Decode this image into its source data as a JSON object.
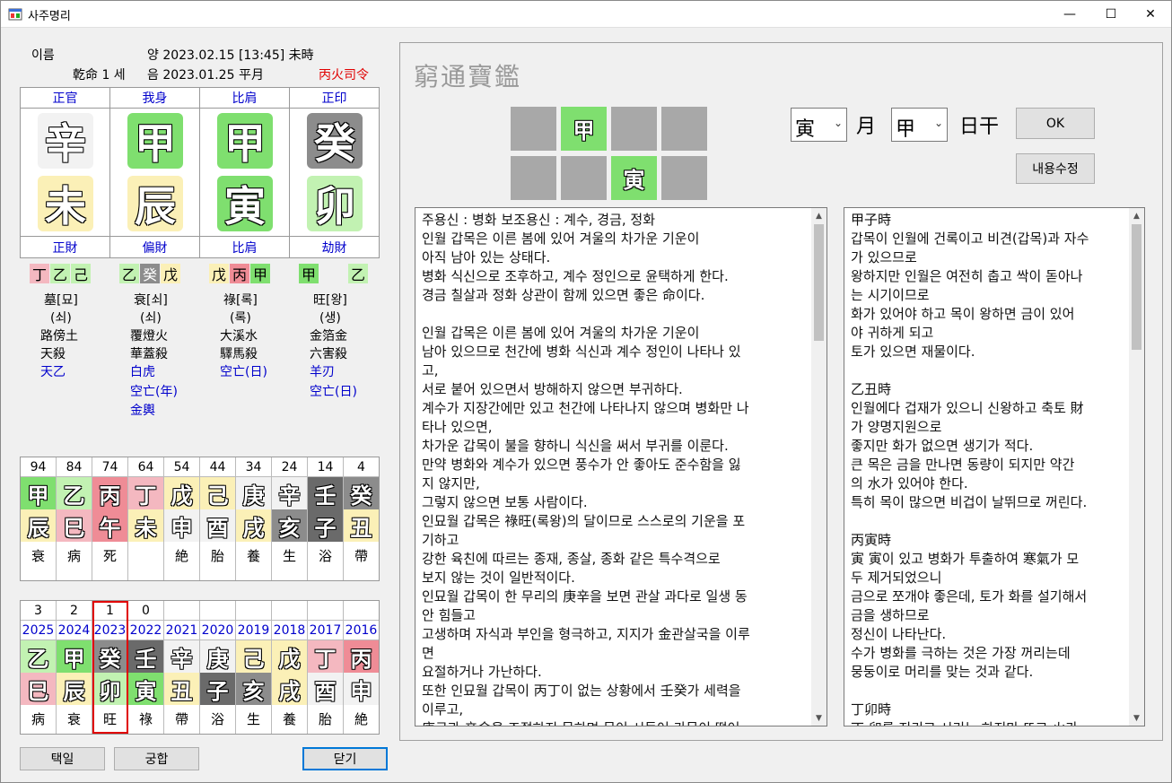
{
  "window": {
    "title": "사주명리",
    "minimize": "—",
    "maximize": "☐",
    "close": "✕"
  },
  "info": {
    "name_label": "이름",
    "solar": "양 2023.02.15  [13:45]  未時",
    "gender_age": "乾命 1 세",
    "lunar": "음 2023.01.25  平月",
    "siryeong": "丙火司令"
  },
  "pillars": {
    "top_labels": [
      "正官",
      "我身",
      "比肩",
      "正印"
    ],
    "stems": [
      "辛",
      "甲",
      "甲",
      "癸"
    ],
    "branches": [
      "未",
      "辰",
      "寅",
      "卯"
    ],
    "bottom_labels": [
      "正財",
      "偏財",
      "比肩",
      "劫財"
    ],
    "hidden": [
      [
        "丁",
        "乙",
        "己"
      ],
      [
        "乙",
        "癸",
        "戊"
      ],
      [
        "戊",
        "丙",
        "甲"
      ],
      [
        "甲",
        "乙"
      ]
    ],
    "stages": [
      "墓[묘]",
      "衰[쇠]",
      "祿[록]",
      "旺[왕]"
    ],
    "sub_stages": [
      "(쇠)",
      "(쇠)",
      "(록)",
      "(생)"
    ],
    "nayin": [
      "路傍土",
      "覆燈火",
      "大溪水",
      "金箔金"
    ],
    "shinsal": [
      "天殺",
      "華蓋殺",
      "驛馬殺",
      "六害殺"
    ],
    "blue_1": [
      "天乙",
      "白虎",
      "空亡(日)",
      "羊刃"
    ],
    "blue_2": [
      "",
      "空亡(年)",
      "",
      "空亡(日)"
    ],
    "blue_3": [
      "",
      "金輿",
      "",
      ""
    ]
  },
  "daeun": {
    "ages": [
      "94",
      "84",
      "74",
      "64",
      "54",
      "44",
      "34",
      "24",
      "14",
      "4"
    ],
    "stems": [
      "甲",
      "乙",
      "丙",
      "丁",
      "戊",
      "己",
      "庚",
      "辛",
      "壬",
      "癸"
    ],
    "branches": [
      "辰",
      "巳",
      "午",
      "未",
      "申",
      "酉",
      "戌",
      "亥",
      "子",
      "丑"
    ],
    "stages": [
      "衰",
      "病",
      "死",
      "",
      "絶",
      "胎",
      "養",
      "生",
      "浴",
      "帶"
    ]
  },
  "seun": {
    "ages": [
      "3",
      "2",
      "1",
      "0",
      "",
      "",
      "",
      "",
      "",
      ""
    ],
    "years": [
      "2025",
      "2024",
      "2023",
      "2022",
      "2021",
      "2020",
      "2019",
      "2018",
      "2017",
      "2016"
    ],
    "stems": [
      "乙",
      "甲",
      "癸",
      "壬",
      "辛",
      "庚",
      "己",
      "戊",
      "丁",
      "丙"
    ],
    "branches": [
      "巳",
      "辰",
      "卯",
      "寅",
      "丑",
      "子",
      "亥",
      "戌",
      "酉",
      "申"
    ],
    "stages": [
      "病",
      "衰",
      "旺",
      "祿",
      "帶",
      "浴",
      "生",
      "養",
      "胎",
      "絶"
    ]
  },
  "buttons": {
    "taegil": "택일",
    "gunghap": "궁합",
    "close": "닫기",
    "ok": "OK",
    "edit": "내용수정"
  },
  "right": {
    "heading": "窮通寶鑑",
    "mini_top": [
      "",
      "甲",
      "",
      ""
    ],
    "mini_bottom": [
      "",
      "",
      "寅",
      ""
    ],
    "month_value": "寅",
    "month_label": "月",
    "day_value": "甲",
    "day_label": "日干"
  },
  "text_left": "주용신 : 병화 보조용신 : 계수, 경금, 정화\n인월 갑목은 이른 봄에 있어 겨울의 차가운 기운이\n아직 남아 있는 상태다.\n병화 식신으로 조후하고, 계수 정인으로 윤택하게 한다.\n경금 칠살과 정화 상관이 함께 있으면 좋은 命이다.\n\n인월 갑목은 이른 봄에 있어 겨울의 차가운 기운이\n남아 있으므로 천간에 병화 식신과 계수 정인이 나타나 있\n고,\n서로 붙어 있으면서 방해하지 않으면 부귀하다.\n계수가 지장간에만 있고 천간에 나타나지 않으며 병화만 나\n타나 있으면,\n차가운 갑목이 불을 향하니 식신을 써서 부귀를 이룬다.\n만약 병화와 계수가 있으면 풍수가 안 좋아도 준수함을 잃\n지 않지만,\n그렇지 않으면 보통 사람이다.\n인묘월 갑목은 祿旺(록왕)의 달이므로 스스로의 기운을 포\n기하고\n강한 육친에 따르는 종재, 종살, 종화 같은 특수격으로\n보지 않는 것이 일반적이다.\n인묘월 갑목이 한 무리의 庚辛을 보면 관살 과다로 일생 동\n안 힘들고\n고생하며 자식과 부인을 형극하고, 지지가 金관살국을 이루\n면\n요절하거나 가난하다.\n또한 인묘월 갑목이 丙丁이 없는 상황에서 壬癸가 세력을\n이루고,\n庚금과 辛金을 조절하지 못하면 목이 시들어 가문이 떨어",
  "text_right": "甲子時\n갑목이 인월에 건록이고 비견(갑목)과 자수\n가 있으므로\n왕하지만 인월은 여전히 춥고 싹이 돋아나\n는 시기이므로\n화가 있어야 하고 목이 왕하면 금이 있어\n야 귀하게 되고\n토가 있으면 재물이다.\n\n乙丑時\n인월에다 겁재가 있으니 신왕하고 축토 財\n가 양명지원으로\n좋지만 화가 없으면 생기가 적다.\n큰 목은 금을 만나면 동량이 되지만 약간\n의 水가 있어야 한다.\n특히 목이 많으면 비겁이 날뛰므로 꺼린다.\n\n丙寅時\n寅 寅이 있고 병화가 투출하여 寒氣가 모\n두 제거되었으니\n금으로 쪼개야 좋은데, 토가 화를 설기해서\n금을 생하므로\n정신이 나타난다.\n수가 병화를 극하는 것은 가장 꺼리는데\n뭉둥이로 머리를 맞는 것과 같다.\n\n丁卯時\n丁 卯를 지키고 시키는 하지만 뜨고 火가"
}
